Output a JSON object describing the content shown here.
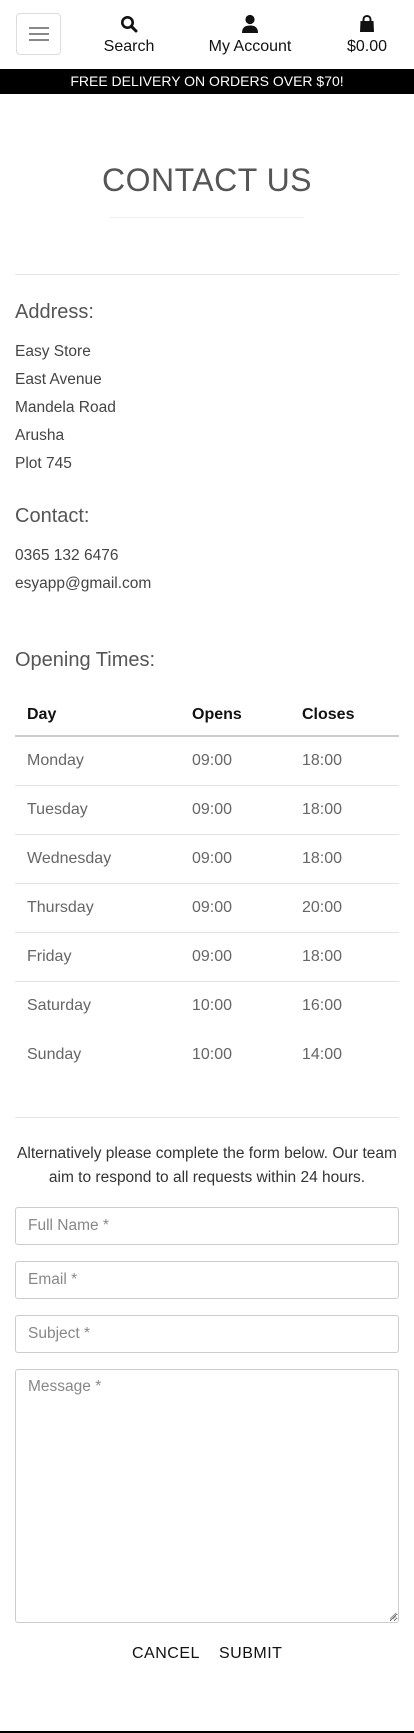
{
  "header": {
    "search_label": "Search",
    "account_label": "My Account",
    "bag_total": "$0.00",
    "icons": {
      "menu": "hamburger-icon",
      "search": "magnifier-icon",
      "account": "user-icon",
      "bag": "shopping-bag-icon"
    }
  },
  "promo": {
    "text": "FREE DELIVERY ON ORDERS OVER $70!"
  },
  "page": {
    "title": "CONTACT US"
  },
  "address": {
    "heading": "Address:",
    "lines": [
      "Easy Store",
      "East Avenue",
      "Mandela Road",
      "Arusha",
      "Plot 745"
    ]
  },
  "contact": {
    "heading": "Contact:",
    "phone": "0365 132 6476",
    "email": "esyapp@gmail.com"
  },
  "hours": {
    "heading": "Opening Times:",
    "columns": [
      "Day",
      "Opens",
      "Closes"
    ],
    "rows": [
      [
        "Monday",
        "09:00",
        "18:00"
      ],
      [
        "Tuesday",
        "09:00",
        "18:00"
      ],
      [
        "Wednesday",
        "09:00",
        "18:00"
      ],
      [
        "Thursday",
        "09:00",
        "20:00"
      ],
      [
        "Friday",
        "09:00",
        "18:00"
      ],
      [
        "Saturday",
        "10:00",
        "16:00"
      ],
      [
        "Sunday",
        "10:00",
        "14:00"
      ]
    ]
  },
  "form": {
    "intro": "Alternatively please complete the form below. Our team aim to respond to all requests within 24 hours.",
    "full_name_placeholder": "Full Name *",
    "email_placeholder": "Email *",
    "subject_placeholder": "Subject *",
    "message_placeholder": "Message *",
    "cancel_label": "CANCEL",
    "submit_label": "SUBMIT"
  }
}
